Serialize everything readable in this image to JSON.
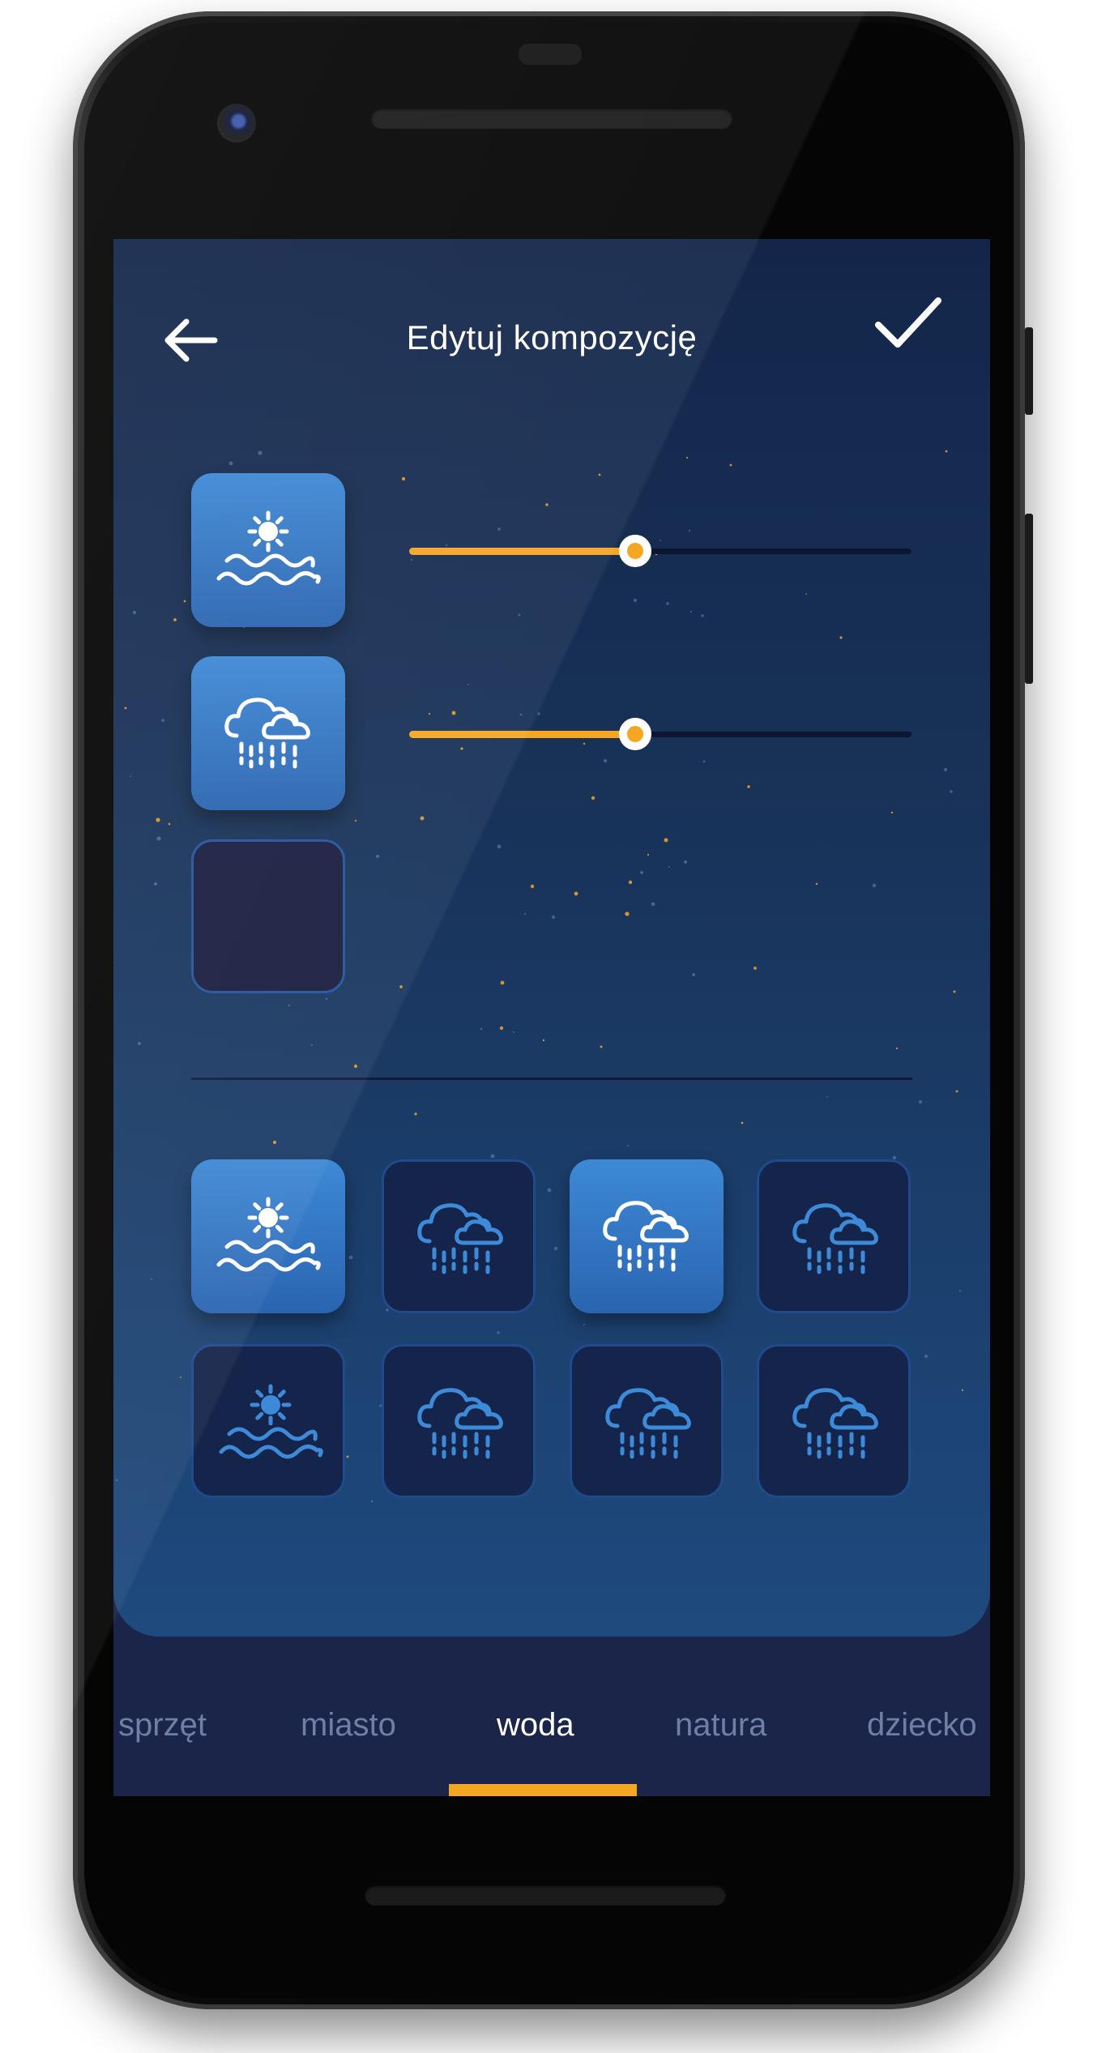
{
  "header": {
    "title": "Edytuj kompozycję",
    "back_icon": "arrow-left-icon",
    "confirm_icon": "check-icon"
  },
  "composition": {
    "slots": [
      {
        "icon": "sun-waves-icon",
        "filled": true,
        "volume": 0.45
      },
      {
        "icon": "cloud-rain-icon",
        "filled": true,
        "volume": 0.45
      },
      {
        "icon": null,
        "filled": false
      }
    ]
  },
  "sounds": {
    "tiles": [
      {
        "icon": "sun-waves-icon",
        "selected": true
      },
      {
        "icon": "cloud-rain-icon",
        "selected": false
      },
      {
        "icon": "cloud-rain-icon",
        "selected": true
      },
      {
        "icon": "cloud-rain-icon",
        "selected": false
      },
      {
        "icon": "sun-waves-icon",
        "selected": false
      },
      {
        "icon": "cloud-rain-icon",
        "selected": false
      },
      {
        "icon": "cloud-rain-icon",
        "selected": false
      },
      {
        "icon": "cloud-rain-icon",
        "selected": false
      }
    ]
  },
  "tabs": {
    "items": [
      "sprzęt",
      "miasto",
      "woda",
      "natura",
      "dziecko"
    ],
    "active_index": 2
  },
  "colors": {
    "accent": "#f5a623",
    "tile_active": "#3d89d6",
    "tile_inactive": "#15244a",
    "icon_inactive": "#3d8ad8",
    "background": "#183258",
    "tabbar": "#1b2449"
  }
}
